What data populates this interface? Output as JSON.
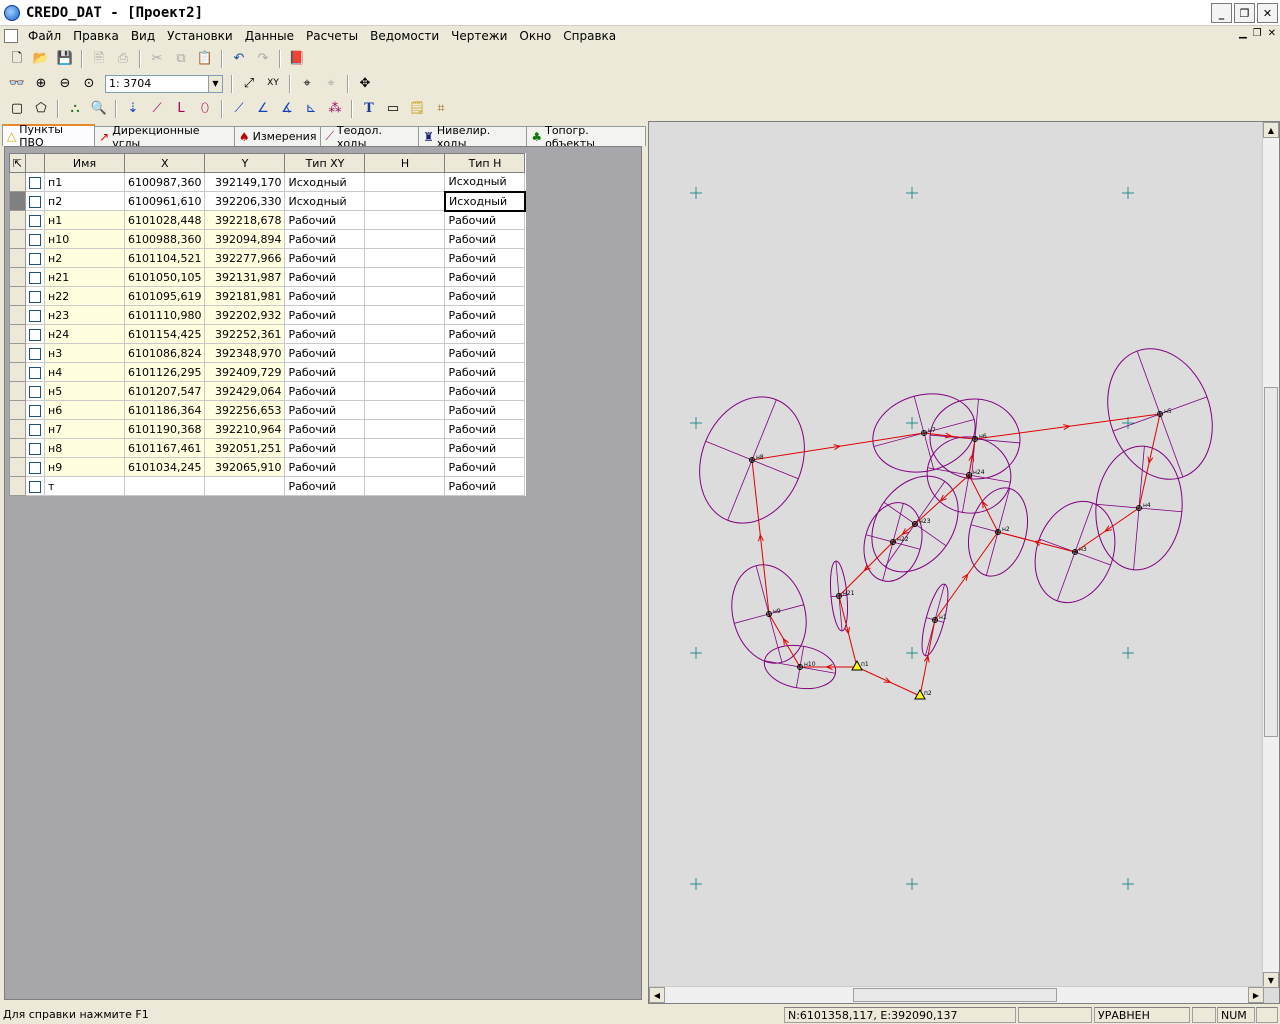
{
  "window": {
    "title": "CREDO_DAT - [Проект2]"
  },
  "menu": [
    "Файл",
    "Правка",
    "Вид",
    "Установки",
    "Данные",
    "Расчеты",
    "Ведомости",
    "Чертежи",
    "Окно",
    "Справка"
  ],
  "toolbar": {
    "scale_value": "1: 3704"
  },
  "tabs": [
    {
      "label": "Пункты ПВО",
      "icon": "point-icon"
    },
    {
      "label": "Дирекционные углы",
      "icon": "direction-angle-icon"
    },
    {
      "label": "Измерения",
      "icon": "tripod-icon"
    },
    {
      "label": "Теодол. ходы",
      "icon": "traverse-icon"
    },
    {
      "label": "Нивелир. ходы",
      "icon": "level-icon"
    },
    {
      "label": "Топогр. объекты",
      "icon": "tree-icon"
    }
  ],
  "table": {
    "columns": [
      "Имя",
      "X",
      "Y",
      "Тип XY",
      "H",
      "Тип H"
    ],
    "rows": [
      {
        "name": "п1",
        "x": "6100987,360",
        "y": "392149,170",
        "type_xy": "Исходный",
        "h": "",
        "type_h": "Исходный"
      },
      {
        "name": "п2",
        "x": "6100961,610",
        "y": "392206,330",
        "type_xy": "Исходный",
        "h": "",
        "type_h": "Исходный"
      },
      {
        "name": "н1",
        "x": "6101028,448",
        "y": "392218,678",
        "type_xy": "Рабочий",
        "h": "",
        "type_h": "Рабочий"
      },
      {
        "name": "н10",
        "x": "6100988,360",
        "y": "392094,894",
        "type_xy": "Рабочий",
        "h": "",
        "type_h": "Рабочий"
      },
      {
        "name": "н2",
        "x": "6101104,521",
        "y": "392277,966",
        "type_xy": "Рабочий",
        "h": "",
        "type_h": "Рабочий"
      },
      {
        "name": "н21",
        "x": "6101050,105",
        "y": "392131,987",
        "type_xy": "Рабочий",
        "h": "",
        "type_h": "Рабочий"
      },
      {
        "name": "н22",
        "x": "6101095,619",
        "y": "392181,981",
        "type_xy": "Рабочий",
        "h": "",
        "type_h": "Рабочий"
      },
      {
        "name": "н23",
        "x": "6101110,980",
        "y": "392202,932",
        "type_xy": "Рабочий",
        "h": "",
        "type_h": "Рабочий"
      },
      {
        "name": "н24",
        "x": "6101154,425",
        "y": "392252,361",
        "type_xy": "Рабочий",
        "h": "",
        "type_h": "Рабочий"
      },
      {
        "name": "н3",
        "x": "6101086,824",
        "y": "392348,970",
        "type_xy": "Рабочий",
        "h": "",
        "type_h": "Рабочий"
      },
      {
        "name": "н4",
        "x": "6101126,295",
        "y": "392409,729",
        "type_xy": "Рабочий",
        "h": "",
        "type_h": "Рабочий"
      },
      {
        "name": "н5",
        "x": "6101207,547",
        "y": "392429,064",
        "type_xy": "Рабочий",
        "h": "",
        "type_h": "Рабочий"
      },
      {
        "name": "н6",
        "x": "6101186,364",
        "y": "392256,653",
        "type_xy": "Рабочий",
        "h": "",
        "type_h": "Рабочий"
      },
      {
        "name": "н7",
        "x": "6101190,368",
        "y": "392210,964",
        "type_xy": "Рабочий",
        "h": "",
        "type_h": "Рабочий"
      },
      {
        "name": "н8",
        "x": "6101167,461",
        "y": "392051,251",
        "type_xy": "Рабочий",
        "h": "",
        "type_h": "Рабочий"
      },
      {
        "name": "н9",
        "x": "6101034,245",
        "y": "392065,910",
        "type_xy": "Рабочий",
        "h": "",
        "type_h": "Рабочий"
      },
      {
        "name": "т",
        "x": "",
        "y": "",
        "type_xy": "Рабочий",
        "h": "",
        "type_h": "Рабочий"
      }
    ]
  },
  "map": {
    "points": [
      {
        "label": "н8",
        "fixed": false
      },
      {
        "label": "н7",
        "fixed": false
      },
      {
        "label": "н6",
        "fixed": false
      },
      {
        "label": "н5",
        "fixed": false
      },
      {
        "label": "н24",
        "fixed": false
      },
      {
        "label": "н23",
        "fixed": false
      },
      {
        "label": "н22",
        "fixed": false
      },
      {
        "label": "н2",
        "fixed": false
      },
      {
        "label": "н4",
        "fixed": false
      },
      {
        "label": "н3",
        "fixed": false
      },
      {
        "label": "н9",
        "fixed": false
      },
      {
        "label": "н21",
        "fixed": false
      },
      {
        "label": "н1",
        "fixed": false
      },
      {
        "label": "н10",
        "fixed": false
      },
      {
        "label": "п1",
        "fixed": true
      },
      {
        "label": "п2",
        "fixed": true
      }
    ],
    "colors": {
      "ellipse": "#800080",
      "traverse": "#e00000",
      "grid_cross": "#2a8a8a",
      "background": "#dcdcdc",
      "fixed_point": "#ffff00"
    }
  },
  "status": {
    "help": "Для справки  нажмите  F1",
    "coords": "N:6101358,117, E:392090,137",
    "mode": "УРАВНЕН",
    "num": "NUM"
  }
}
